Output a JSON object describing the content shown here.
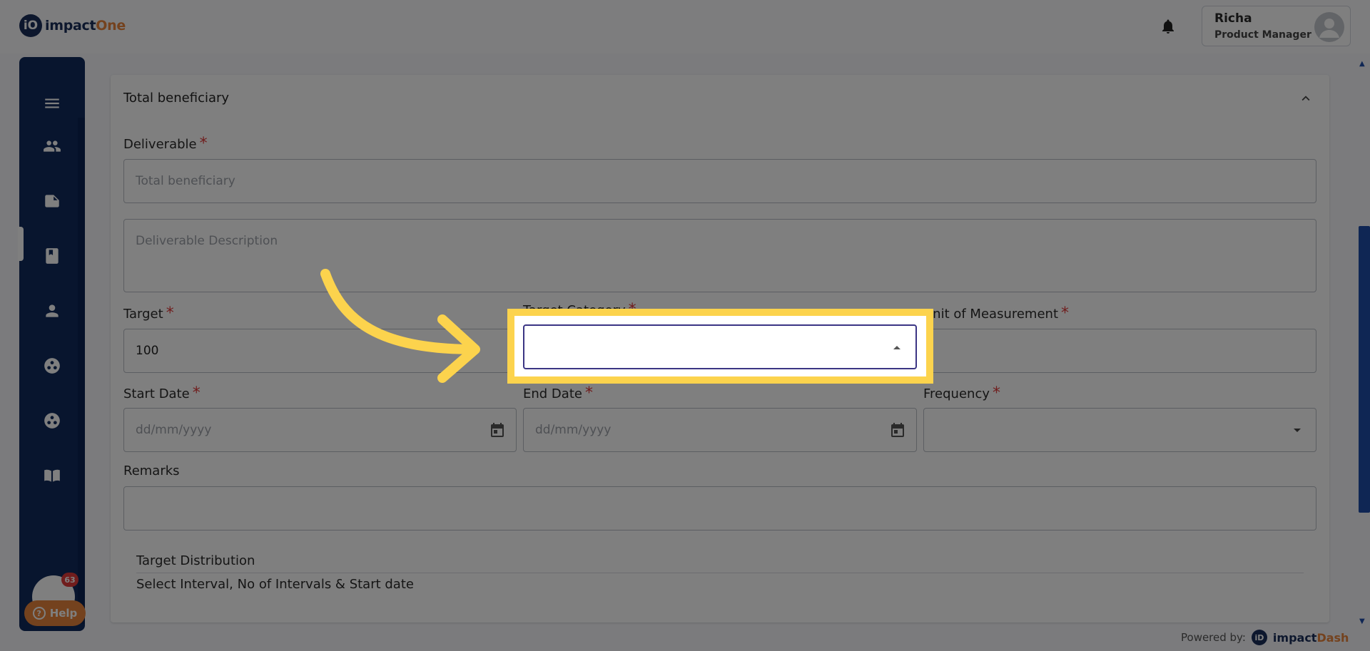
{
  "app": {
    "logo_badge": "iO",
    "logo_name_main": "impact",
    "logo_name_accent": "One"
  },
  "header": {
    "user_name": "Richa",
    "user_role": "Product Manager"
  },
  "sidebar": {
    "items": [
      {
        "icon": "menu-icon"
      },
      {
        "icon": "users-icon"
      },
      {
        "icon": "folder-icon"
      },
      {
        "icon": "book-icon"
      },
      {
        "icon": "person-icon"
      },
      {
        "icon": "hub-icon"
      },
      {
        "icon": "hub-icon"
      },
      {
        "icon": "reader-icon"
      }
    ],
    "notification_count": "63",
    "help_label": "Help"
  },
  "card": {
    "title": "Total beneficiary",
    "deliverable_label": "Deliverable",
    "deliverable_value": "Total beneficiary",
    "description_placeholder": "Deliverable Description",
    "target_label": "Target",
    "target_value": "100",
    "target_category_label": "Target Category",
    "unit_label": "Unit of Measurement",
    "start_date_label": "Start Date",
    "start_date_placeholder": "dd/mm/yyyy",
    "end_date_label": "End Date",
    "end_date_placeholder": "dd/mm/yyyy",
    "frequency_label": "Frequency",
    "remarks_label": "Remarks",
    "distribution_title": "Target Distribution",
    "distribution_sub": "Select Interval, No of Intervals & Start date"
  },
  "footer": {
    "powered_label": "Powered by:",
    "brand_badge": "iD",
    "brand_main": "impact",
    "brand_accent": "Dash"
  },
  "required_mark": "*",
  "colors": {
    "sidebar": "#102a5c",
    "accent_orange": "#e8843c",
    "highlight": "#fcd34d",
    "focus_border": "#3b3584"
  }
}
